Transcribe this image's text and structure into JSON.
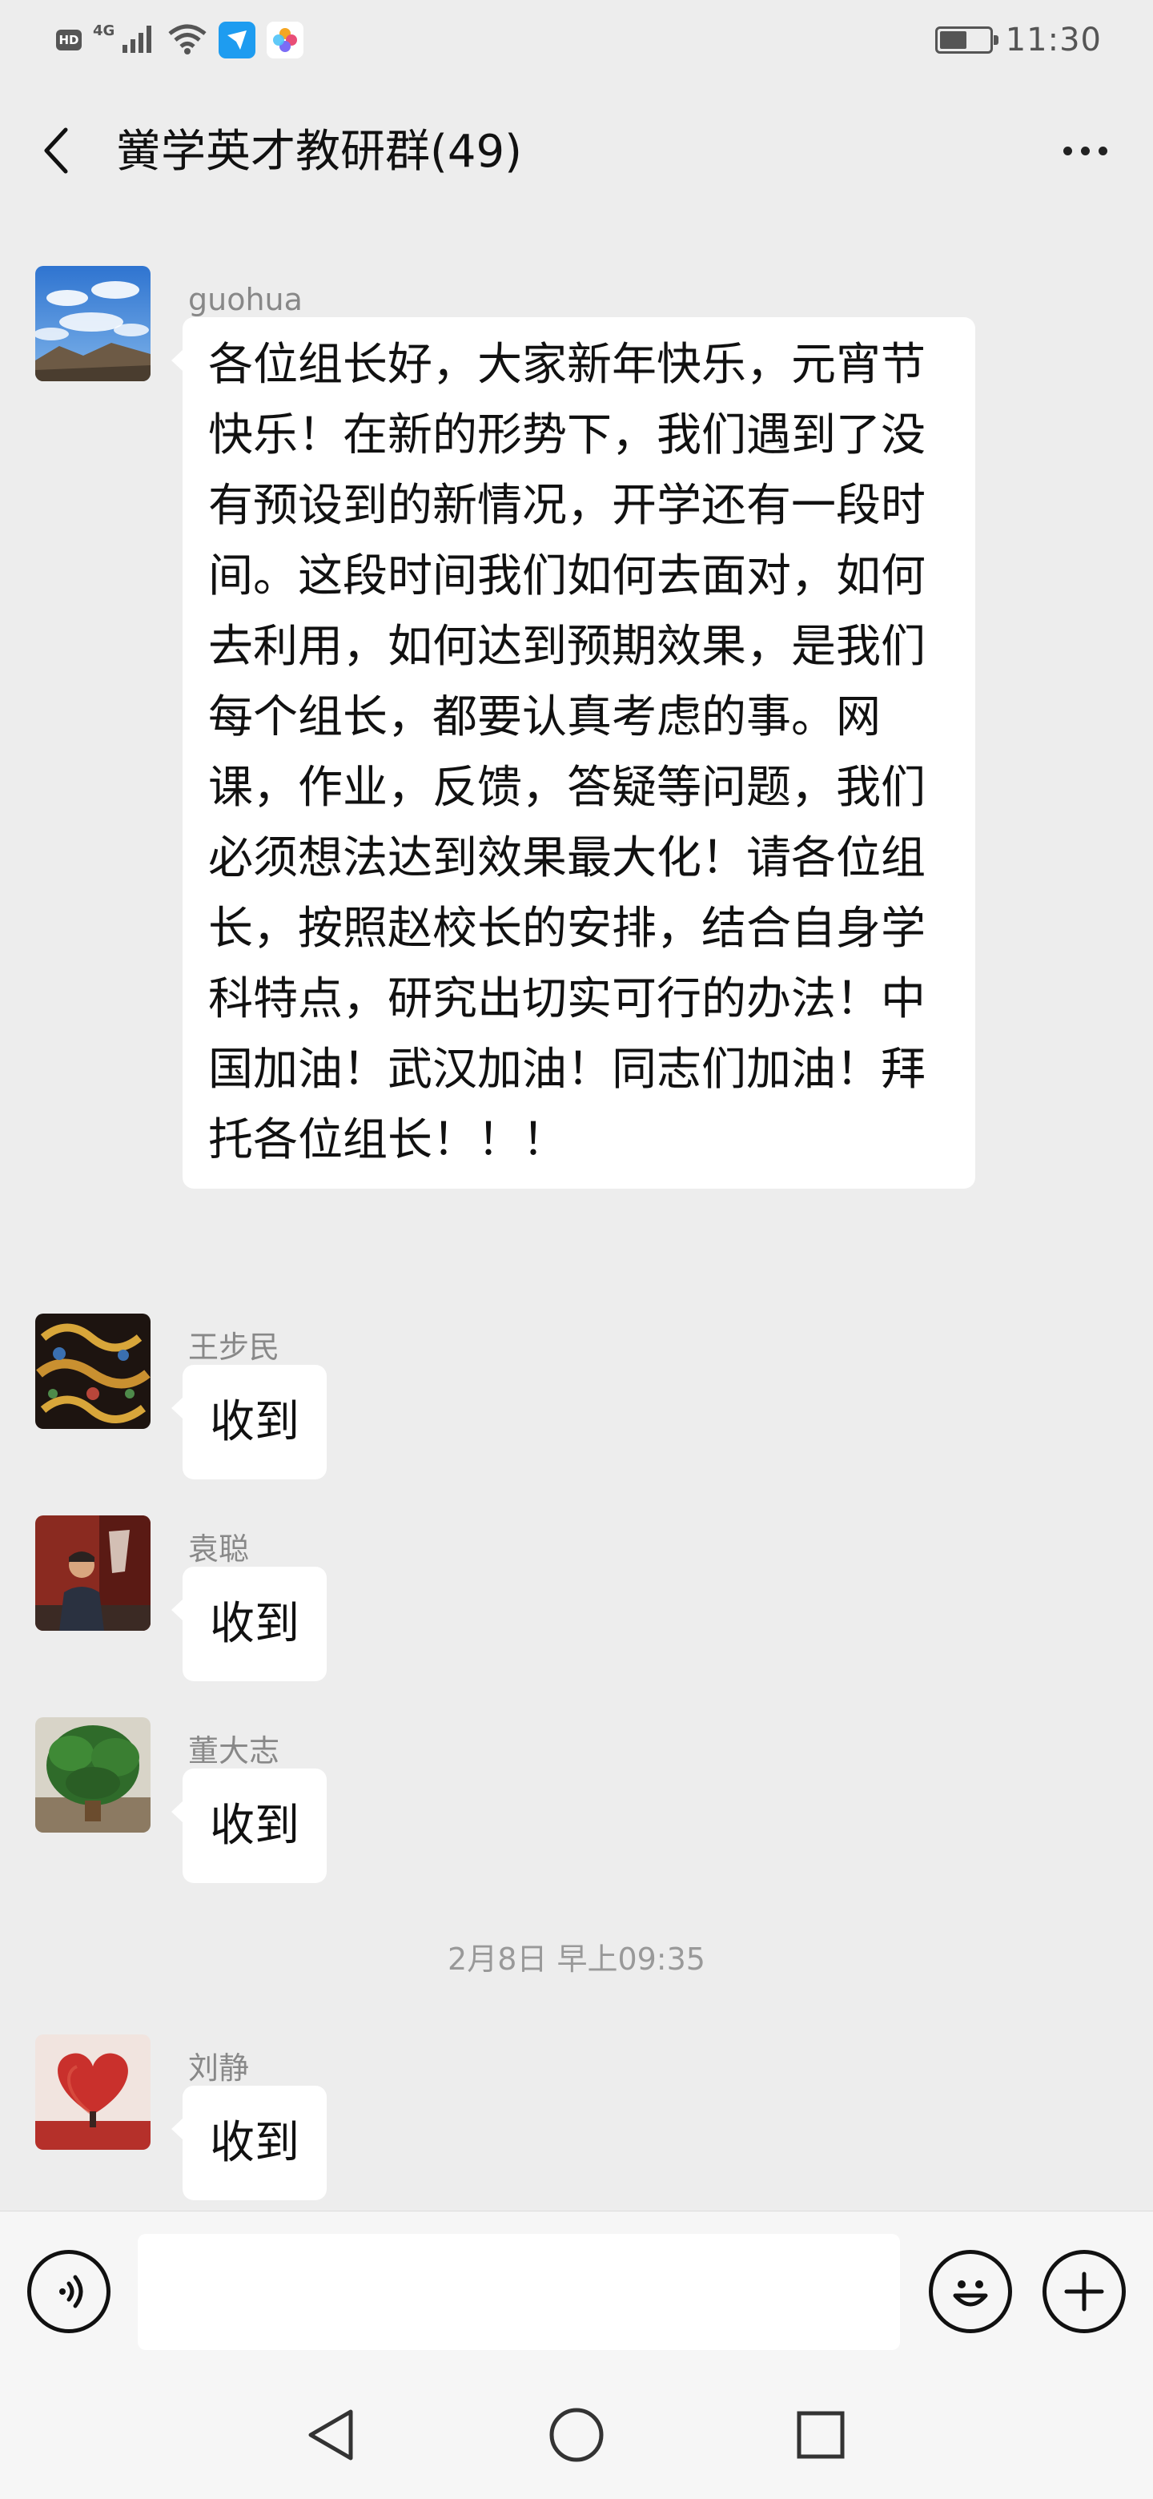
{
  "status_bar": {
    "hd_label": "HD",
    "network_label": "4G",
    "time": "11:30",
    "battery_level": 0.55,
    "icons": [
      "signal-icon",
      "wifi-icon",
      "feishu-app-icon",
      "photo-app-icon",
      "battery-icon"
    ]
  },
  "header": {
    "title": "黉学英才教研群(49)",
    "back_icon": "chevron-left-icon",
    "more_icon": "more-dots-icon"
  },
  "messages": [
    {
      "sender": "guohua",
      "text": "各位组长好，大家新年快乐，元宵节快乐！在新的形势下，我们遇到了没有预设到的新情况，开学还有一段时间。这段时间我们如何去面对，如何去利用，如何达到预期效果，是我们每个组长，都要认真考虑的事。网课，作业，反馈，答疑等问题，我们必须想法达到效果最大化！请各位组长，按照赵校长的安排，结合自身学科特点，研究出切实可行的办法！中国加油！武汉加油！同志们加油！拜托各位组长！！！"
    },
    {
      "sender": "王步民",
      "text": "收到"
    },
    {
      "sender": "袁聪",
      "text": "收到"
    },
    {
      "sender": "董大志",
      "text": "收到"
    },
    {
      "sender": "刘静",
      "text": "收到"
    }
  ],
  "time_divider": "2月8日 早上09:35",
  "input_bar": {
    "placeholder": "",
    "value": "",
    "icons": [
      "voice-icon",
      "emoji-icon",
      "plus-icon"
    ]
  },
  "nav_bar": {
    "icons": [
      "nav-back-icon",
      "nav-home-icon",
      "nav-recent-icon"
    ]
  },
  "colors": {
    "background": "#ededed",
    "bubble": "#ffffff",
    "sender_name": "#888888",
    "time_divider": "#999999"
  }
}
